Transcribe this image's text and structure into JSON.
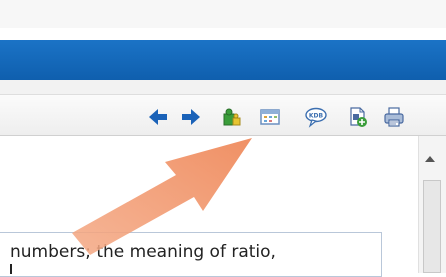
{
  "toolbar": {
    "icons": [
      {
        "name": "back-arrow-icon",
        "color": "#1a62b8"
      },
      {
        "name": "forward-arrow-icon",
        "color": "#1a62b8"
      },
      {
        "name": "puzzle-icon",
        "color": "#3a9d3a"
      },
      {
        "name": "table-icon",
        "color": "#6a8fc0"
      },
      {
        "name": "kdb-speech-icon",
        "label": "KDB",
        "color": "#3c6fb0"
      },
      {
        "name": "document-add-icon",
        "color": "#3a9d3a"
      },
      {
        "name": "printer-icon",
        "color": "#4a6aa0"
      }
    ]
  },
  "content": {
    "text": "numbers; the meaning of ratio,"
  },
  "annotation": {
    "arrow_color": "#f0936a"
  },
  "colors": {
    "header_blue": "#1366b8",
    "toolbar_bg": "#f0f0f0"
  }
}
